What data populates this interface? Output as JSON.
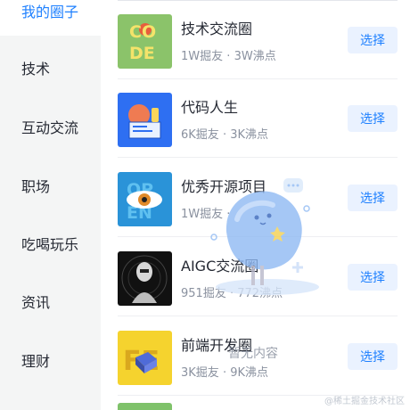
{
  "sidebar": {
    "items": [
      {
        "label": "我的圈子",
        "active": true
      },
      {
        "label": "技术",
        "active": false
      },
      {
        "label": "互动交流",
        "active": false
      },
      {
        "label": "职场",
        "active": false
      },
      {
        "label": "吃喝玩乐",
        "active": false
      },
      {
        "label": "资讯",
        "active": false
      },
      {
        "label": "理财",
        "active": false
      }
    ]
  },
  "circles": [
    {
      "name": "技术交流圈",
      "members": "1W掘友",
      "dot": "·",
      "posts": "3W沸点",
      "button": "选择",
      "logo_text_1": "CO",
      "logo_text_2": "DE"
    },
    {
      "name": "代码人生",
      "members": "6K掘友",
      "dot": "·",
      "posts": "3K沸点",
      "button": "选择"
    },
    {
      "name": "优秀开源项目",
      "members": "1W掘友",
      "dot": "·",
      "posts": "",
      "button": "选择",
      "logo_text_1": "OP",
      "logo_text_2": "EN"
    },
    {
      "name": "AIGC交流圈",
      "members": "951掘友",
      "dot": "·",
      "posts": "772沸点",
      "button": "选择"
    },
    {
      "name": "前端开发圈",
      "members": "3K掘友",
      "dot": "·",
      "posts": "9K沸点",
      "button": "选择",
      "logo_text_1": "FE"
    }
  ],
  "empty_state": {
    "text": "暂无内容"
  },
  "watermark": "@稀土掘金技术社区",
  "colors": {
    "accent": "#1e80ff",
    "button_bg": "#eaf2ff",
    "sidebar_bg": "#f4f5f5"
  }
}
